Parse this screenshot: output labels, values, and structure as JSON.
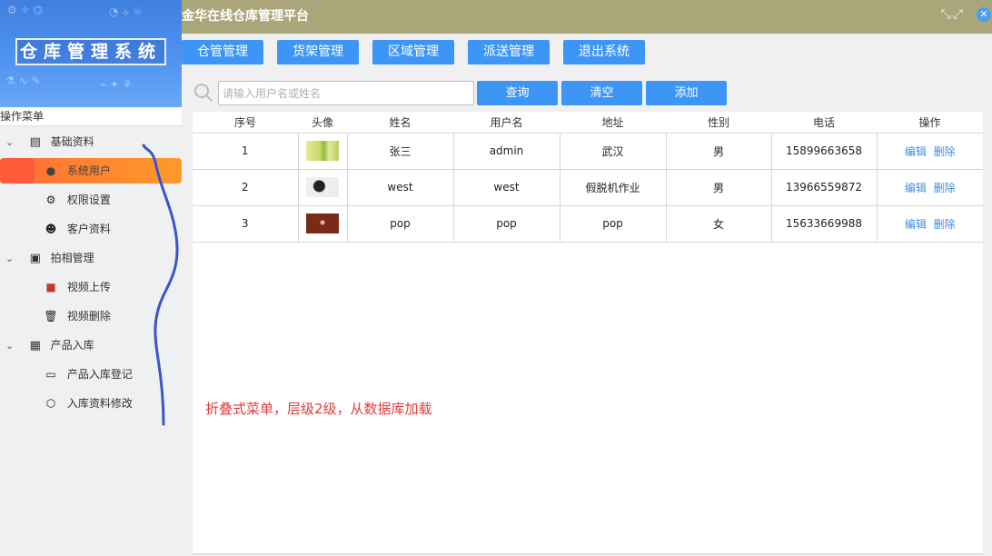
{
  "logo": {
    "title": "仓库管理系统"
  },
  "menu_header": "操作菜单",
  "menu": {
    "groups": [
      {
        "label": "基础资料",
        "icon": "document-icon",
        "items": [
          {
            "label": "系统用户",
            "icon": "user-icon",
            "active": true
          },
          {
            "label": "权限设置",
            "icon": "user-settings-icon"
          },
          {
            "label": "客户资料",
            "icon": "users-icon"
          }
        ]
      },
      {
        "label": "拍相管理",
        "icon": "portrait-icon",
        "items": [
          {
            "label": "视频上传",
            "icon": "video-camera-icon"
          },
          {
            "label": "视频删除",
            "icon": "trash-icon"
          }
        ]
      },
      {
        "label": "产品入库",
        "icon": "warehouse-icon",
        "items": [
          {
            "label": "产品入库登记",
            "icon": "register-icon"
          },
          {
            "label": "入库资料修改",
            "icon": "box-icon"
          }
        ]
      }
    ]
  },
  "topbar": {
    "title": "金华在线仓库管理平台"
  },
  "nav": [
    "仓管管理",
    "货架管理",
    "区域管理",
    "派送管理",
    "退出系统"
  ],
  "search": {
    "placeholder": "请输入用户名或姓名",
    "value": ""
  },
  "actions": {
    "query": "查询",
    "clear": "清空",
    "add": "添加"
  },
  "table": {
    "headers": [
      "序号",
      "头像",
      "姓名",
      "用户名",
      "地址",
      "性别",
      "电话",
      "操作"
    ],
    "rows": [
      {
        "no": "1",
        "name": "张三",
        "username": "admin",
        "address": "武汉",
        "gender": "男",
        "phone": "15899663658"
      },
      {
        "no": "2",
        "name": "west",
        "username": "west",
        "address": "假脱机作业",
        "gender": "男",
        "phone": "13966559872"
      },
      {
        "no": "3",
        "name": "pop",
        "username": "pop",
        "address": "pop",
        "gender": "女",
        "phone": "15633669988"
      }
    ],
    "edit_label": "编辑",
    "delete_label": "删除"
  },
  "annotation": "折叠式菜单，层级2级，从数据库加载",
  "colors": {
    "accent": "#3d96f5",
    "topbar": "#aaa67a",
    "active_menu": "#ff7a30",
    "annotation": "#e03a3a"
  }
}
